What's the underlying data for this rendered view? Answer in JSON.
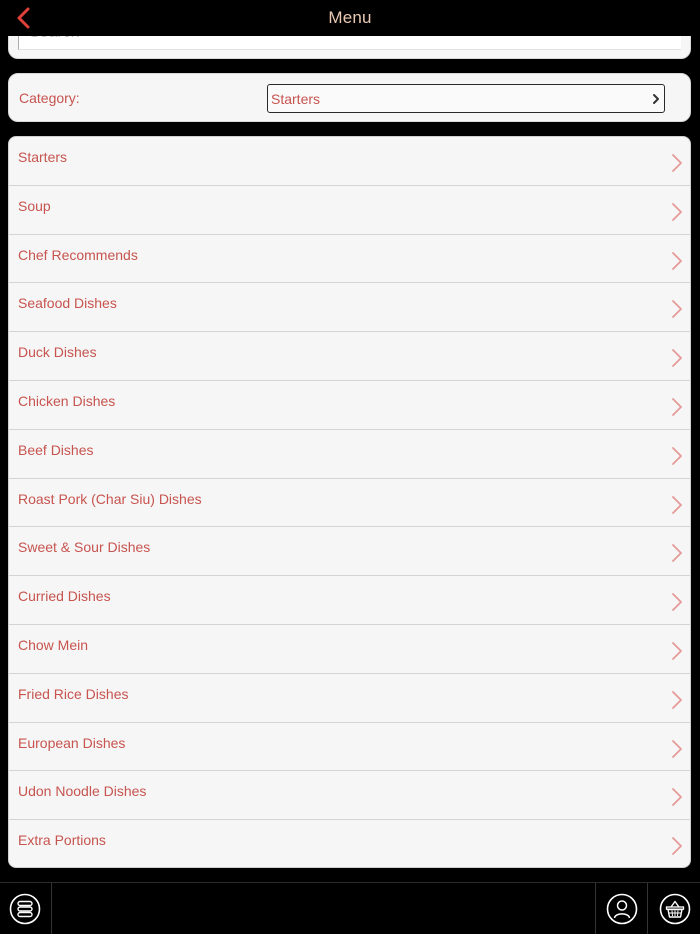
{
  "header": {
    "title": "Menu",
    "back_icon": "chevron-left-icon",
    "accent_color": "#e0403a",
    "title_color": "#e9c9b4"
  },
  "search": {
    "placeholder": "Search",
    "value": ""
  },
  "category": {
    "label": "Category:",
    "selected": "Starters"
  },
  "menu_items": [
    "Starters",
    "Soup",
    "Chef Recommends",
    "Seafood Dishes",
    "Duck Dishes",
    "Chicken Dishes",
    "Beef Dishes",
    "Roast Pork (Char Siu) Dishes",
    "Sweet & Sour Dishes",
    "Curried Dishes",
    "Chow Mein",
    "Fried Rice Dishes",
    "European Dishes",
    "Udon Noodle Dishes",
    "Extra Portions"
  ],
  "bottom_bar": {
    "left_icon": "menu-stack-icon",
    "right_icons": [
      "account-icon",
      "basket-icon"
    ]
  },
  "colors": {
    "text_accent": "#c7544f",
    "chevron": "#e59a97",
    "card_bg": "#f6f6f6"
  }
}
